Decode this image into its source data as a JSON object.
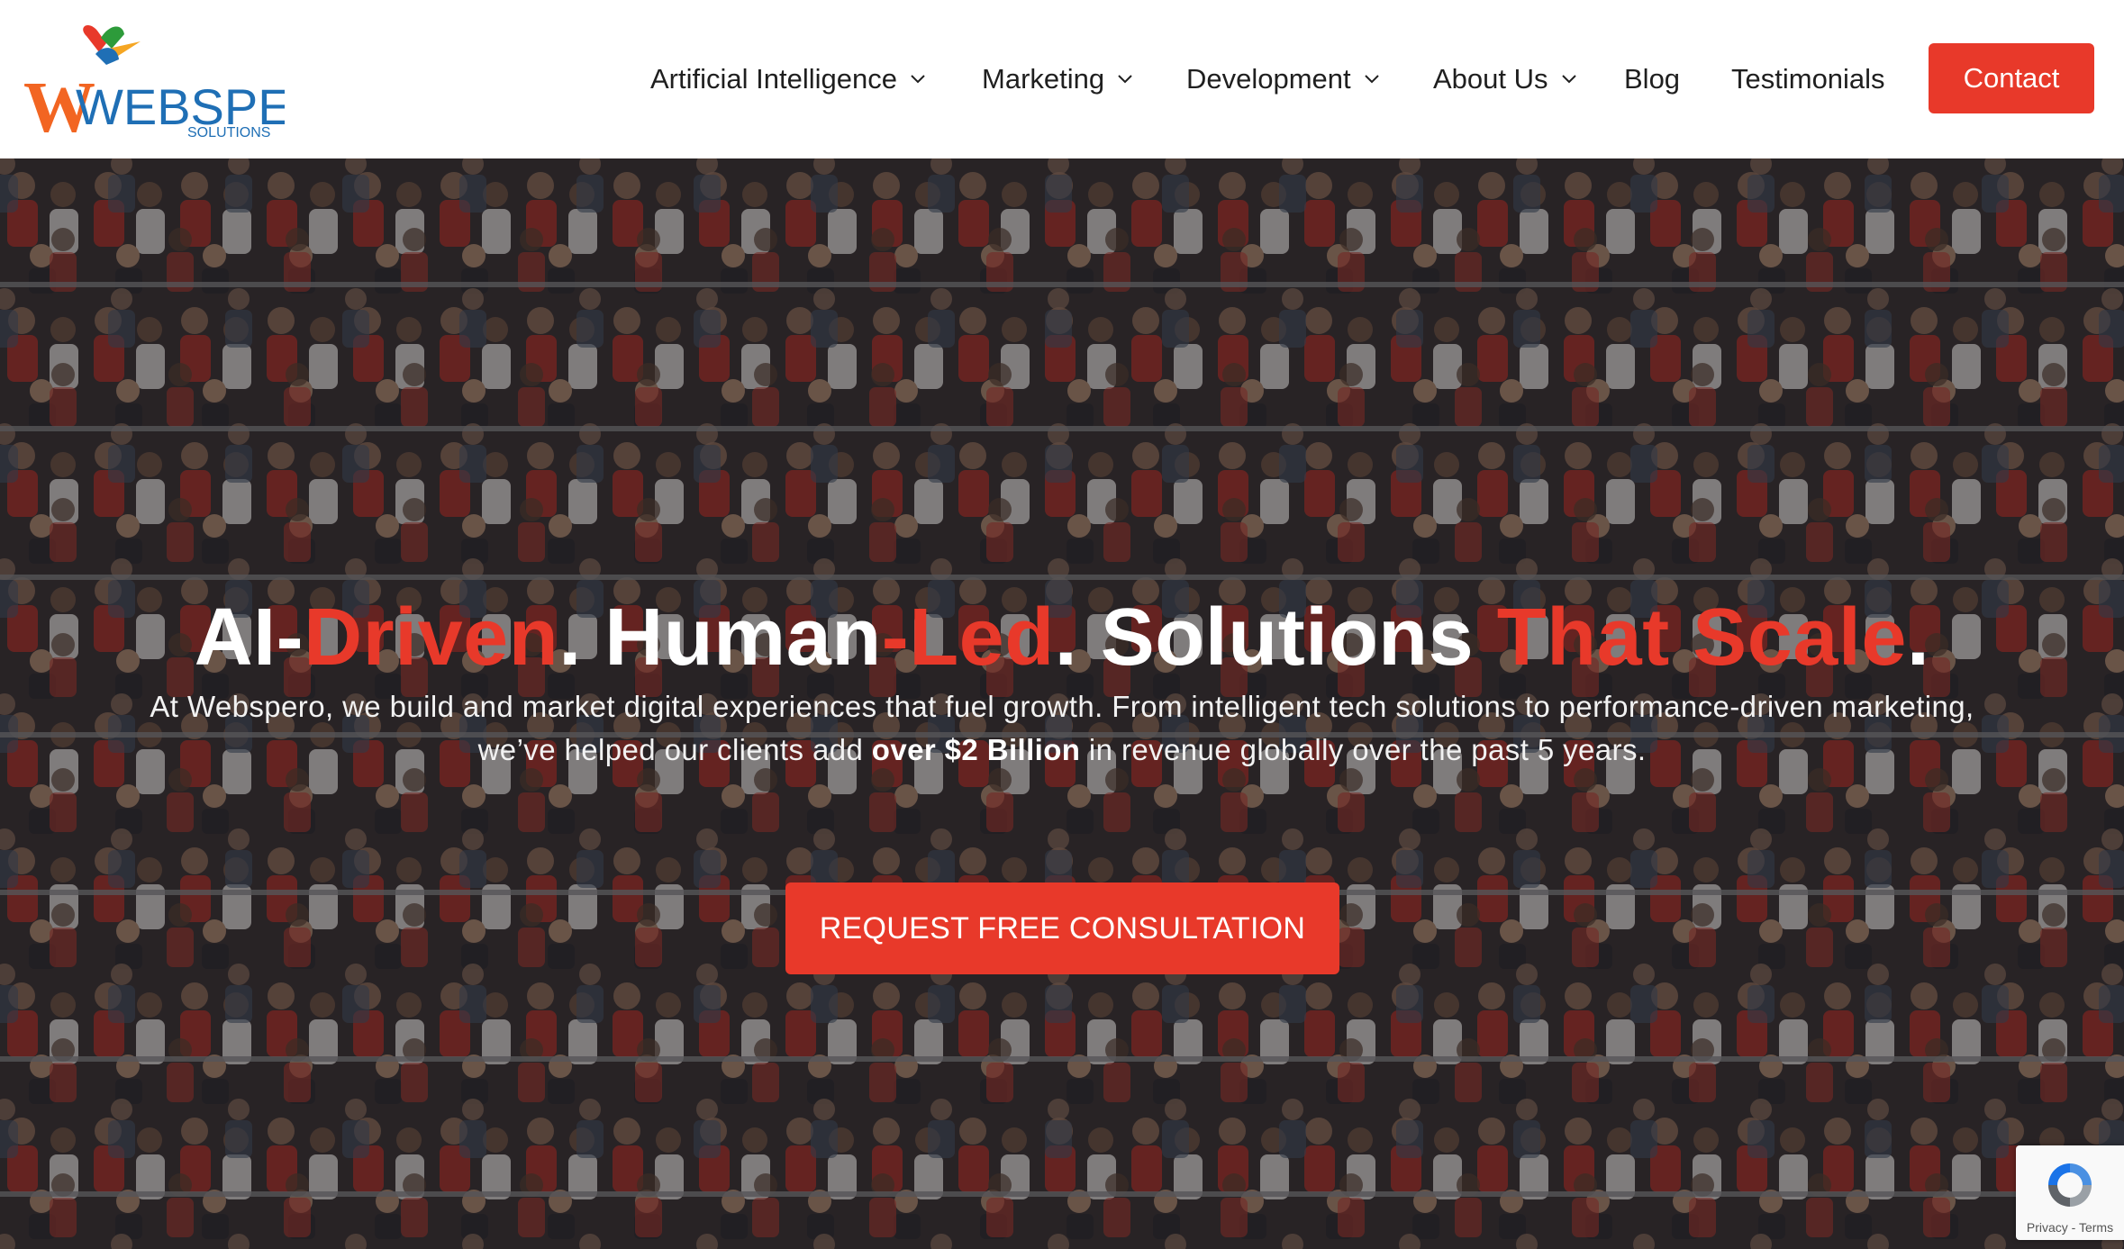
{
  "logo": {
    "wordmark": "WEBSPERO",
    "tagline": "SOLUTIONS"
  },
  "nav": {
    "items": [
      {
        "label": "Artificial Intelligence",
        "dropdown": true
      },
      {
        "label": "Marketing",
        "dropdown": true
      },
      {
        "label": "Development",
        "dropdown": true
      },
      {
        "label": "About Us",
        "dropdown": true
      },
      {
        "label": "Blog",
        "dropdown": false
      },
      {
        "label": "Testimonials",
        "dropdown": false
      }
    ],
    "contact_label": "Contact"
  },
  "hero": {
    "headline": {
      "p1": "AI-",
      "p2": "Driven",
      "p3": ". Human",
      "p4": "-Led",
      "p5": ". Solutions ",
      "p6": "That Scale",
      "p7": "."
    },
    "subtext": {
      "before": "At Webspero, we build and market digital experiences that fuel growth. From intelligent tech solutions to performance-driven marketing, we’ve helped our clients add ",
      "bold": "over $2 Billion",
      "after": " in revenue globally over the past 5 years."
    },
    "cta_label": "REQUEST FREE CONSULTATION"
  },
  "recaptcha": {
    "text": "Privacy - Terms"
  },
  "colors": {
    "accent": "#e8392a",
    "header_bg": "#ffffff",
    "nav_text": "#1f1f1f"
  }
}
